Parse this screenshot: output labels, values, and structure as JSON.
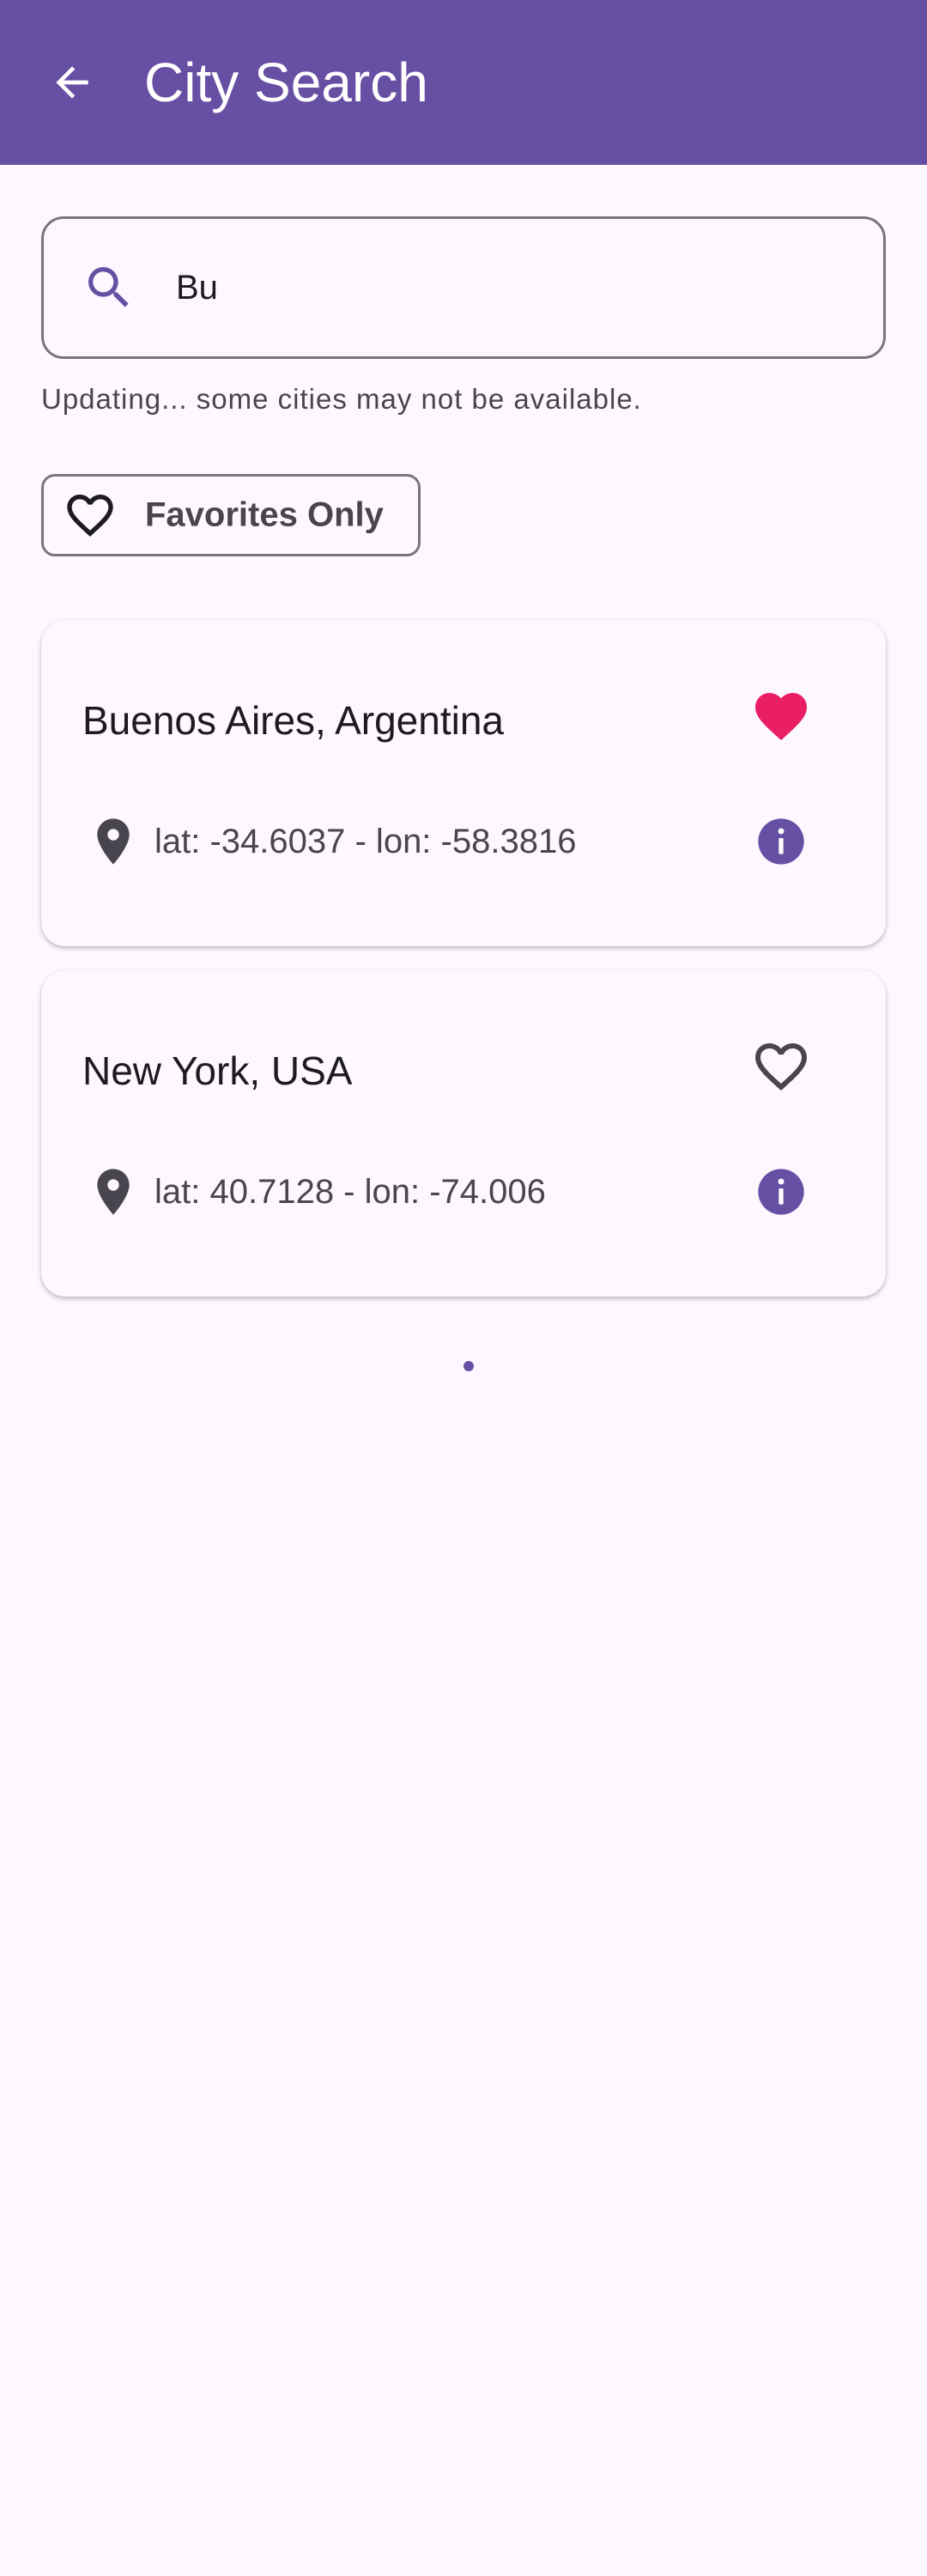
{
  "app_bar": {
    "title": "City Search",
    "back_icon": "arrow-back-icon",
    "background": "#6750A4"
  },
  "search": {
    "value": "Bu",
    "placeholder": "",
    "icon": "search-icon"
  },
  "helper_text": "Updating... some cities may not be available.",
  "filter": {
    "label": "Favorites Only",
    "icon": "heart-outline-icon",
    "selected": false
  },
  "cities": [
    {
      "name": "Buenos Aires, Argentina",
      "coords": "lat: -34.6037 - lon: -58.3816",
      "favorite": true,
      "favorite_icon": "heart-filled-icon",
      "favorite_color": "#E91E63"
    },
    {
      "name": "New York, USA",
      "coords": "lat: 40.7128 - lon: -74.006",
      "favorite": false,
      "favorite_icon": "heart-outline-icon",
      "favorite_color": "#49454F"
    }
  ],
  "colors": {
    "primary": "#6750A4",
    "background": "#FDF7FF",
    "favorite": "#E91E63",
    "on_surface_variant": "#49454F"
  }
}
